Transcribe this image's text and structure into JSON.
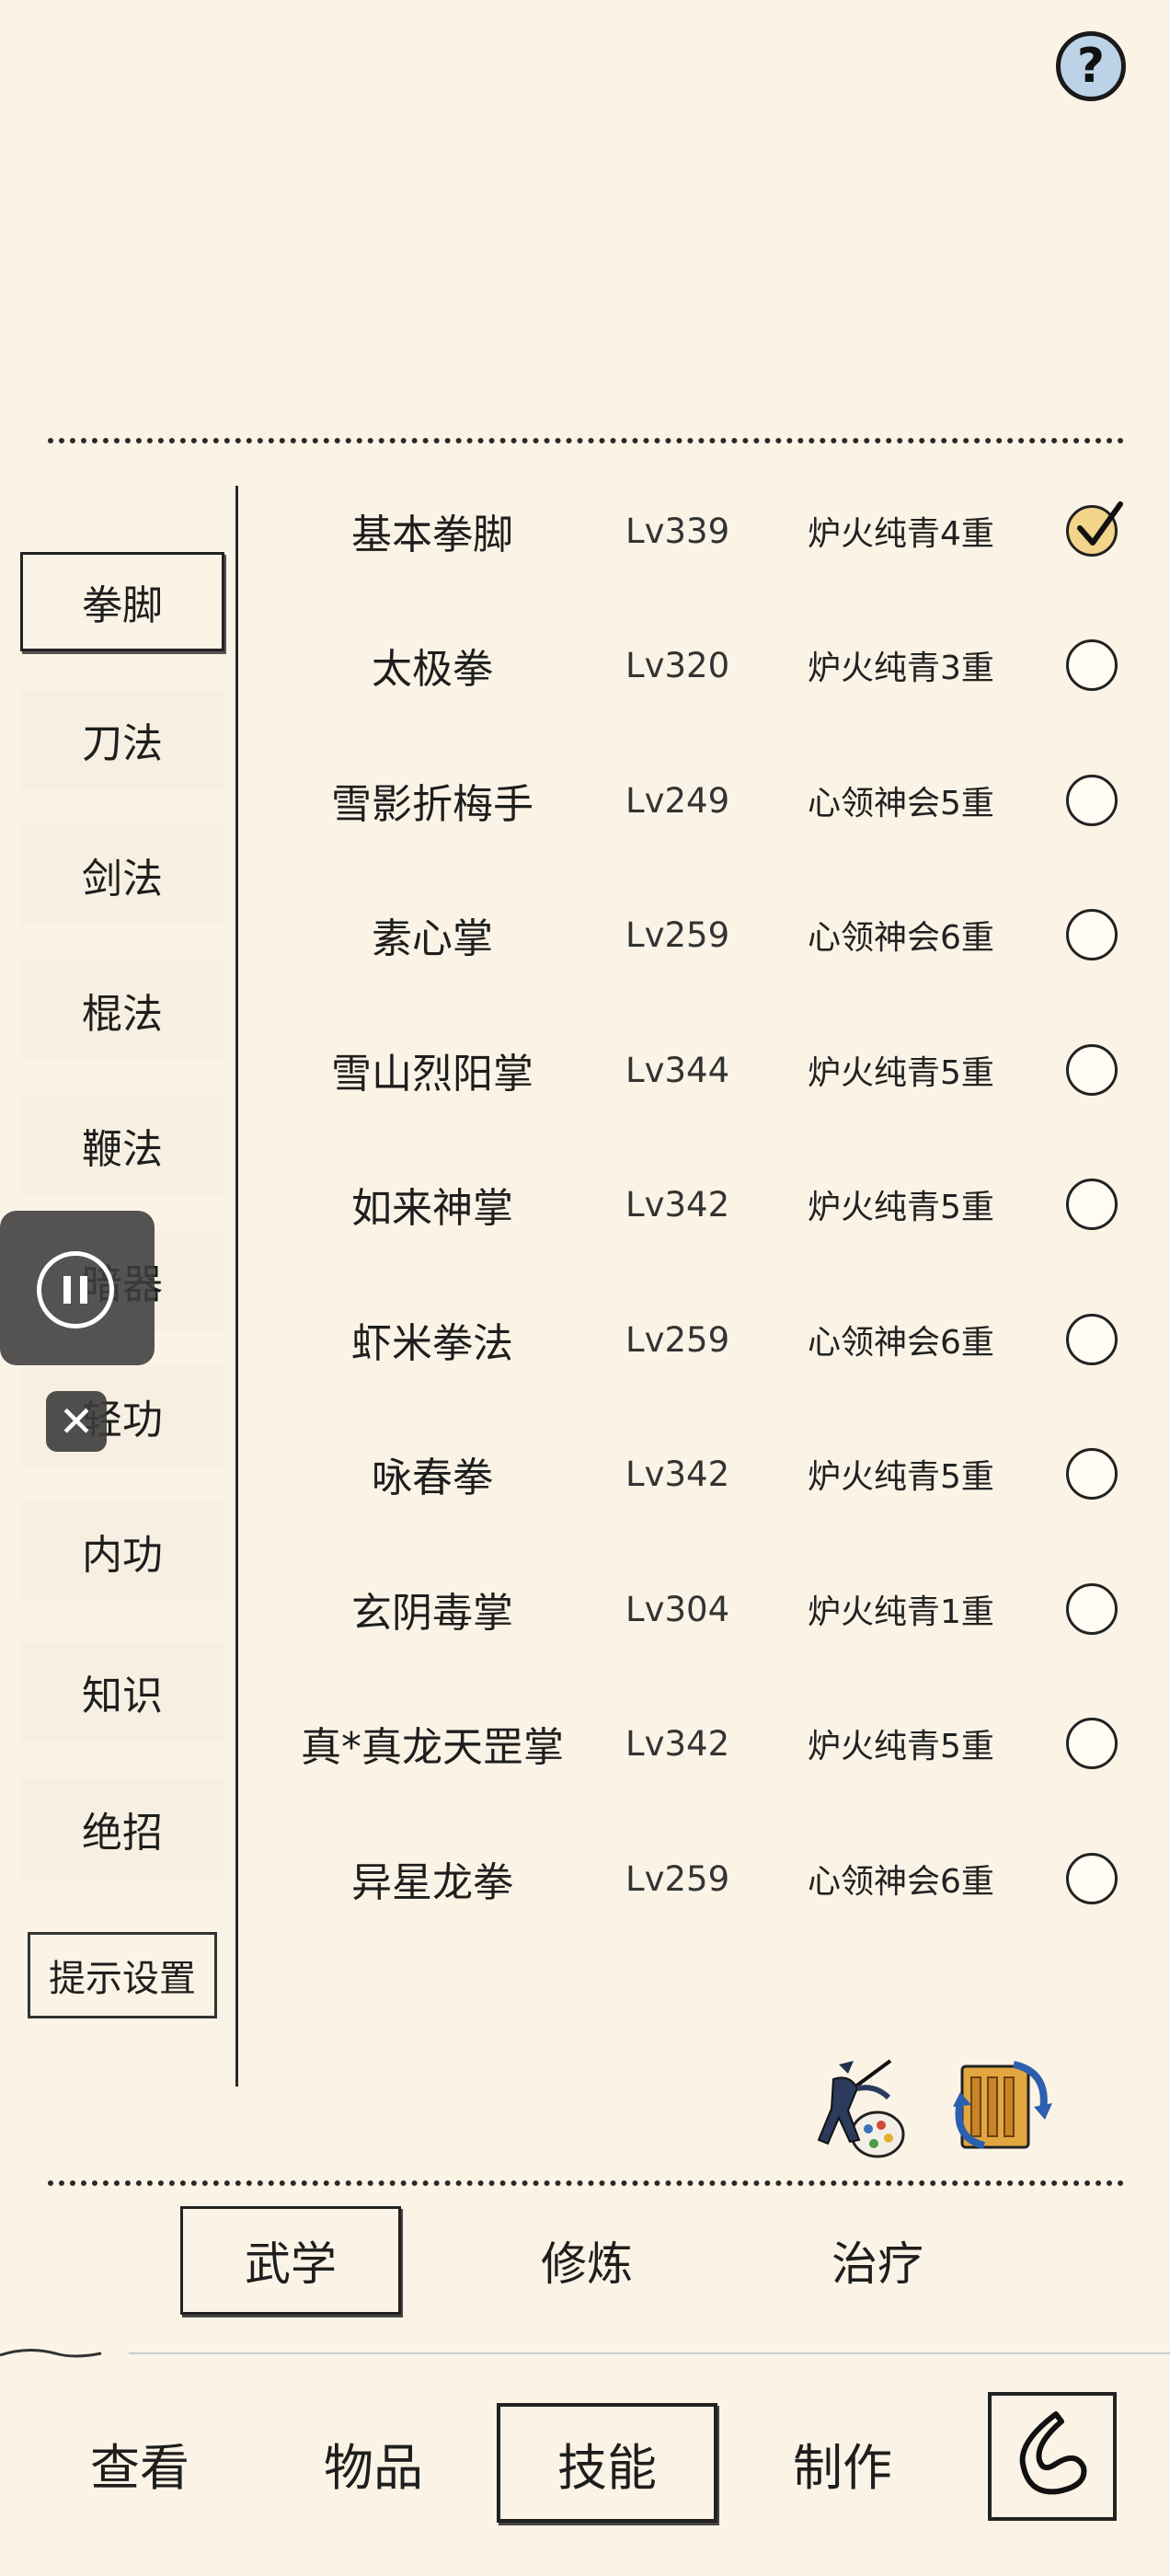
{
  "help": {
    "icon": "question-icon",
    "label": "?"
  },
  "categories": [
    {
      "label": "拳脚",
      "selected": true
    },
    {
      "label": "刀法",
      "selected": false
    },
    {
      "label": "剑法",
      "selected": false
    },
    {
      "label": "棍法",
      "selected": false
    },
    {
      "label": "鞭法",
      "selected": false
    },
    {
      "label": "暗器",
      "selected": false
    },
    {
      "label": "轻功",
      "selected": false
    },
    {
      "label": "内功",
      "selected": false
    },
    {
      "label": "知识",
      "selected": false
    },
    {
      "label": "绝招",
      "selected": false
    }
  ],
  "hint_settings_label": "提示设置",
  "skills": [
    {
      "name": "基本拳脚",
      "level": "Lv339",
      "rank": "炉火纯青4重",
      "checked": true
    },
    {
      "name": "太极拳",
      "level": "Lv320",
      "rank": "炉火纯青3重",
      "checked": false
    },
    {
      "name": "雪影折梅手",
      "level": "Lv249",
      "rank": "心领神会5重",
      "checked": false
    },
    {
      "name": "素心掌",
      "level": "Lv259",
      "rank": "心领神会6重",
      "checked": false
    },
    {
      "name": "雪山烈阳掌",
      "level": "Lv344",
      "rank": "炉火纯青5重",
      "checked": false
    },
    {
      "name": "如来神掌",
      "level": "Lv342",
      "rank": "炉火纯青5重",
      "checked": false
    },
    {
      "name": "虾米拳法",
      "level": "Lv259",
      "rank": "心领神会6重",
      "checked": false
    },
    {
      "name": "咏春拳",
      "level": "Lv342",
      "rank": "炉火纯青5重",
      "checked": false
    },
    {
      "name": "玄阴毒掌",
      "level": "Lv304",
      "rank": "炉火纯青1重",
      "checked": false
    },
    {
      "name": "真*真龙天罡掌",
      "level": "Lv342",
      "rank": "炉火纯青5重",
      "checked": false
    },
    {
      "name": "异星龙拳",
      "level": "Lv259",
      "rank": "心领神会6重",
      "checked": false
    }
  ],
  "tools": [
    {
      "icon": "martial-artist-palette-icon"
    },
    {
      "icon": "scroll-swap-icon"
    }
  ],
  "sub_tabs": [
    {
      "label": "武学",
      "selected": true
    },
    {
      "label": "修炼",
      "selected": false
    },
    {
      "label": "治疗",
      "selected": false
    }
  ],
  "nav_tabs": [
    {
      "label": "查看",
      "selected": false
    },
    {
      "label": "物品",
      "selected": false
    },
    {
      "label": "技能",
      "selected": true
    },
    {
      "label": "制作",
      "selected": false
    }
  ],
  "back_button": {
    "icon": "back-arrow-icon"
  },
  "overlay": {
    "pause_icon": "pause-icon",
    "close_icon": "close-icon",
    "close_glyph": "✕"
  },
  "colors": {
    "background": "#fbf4e6",
    "ink": "#1e1e1e",
    "check_fill": "#f2d48a",
    "help_fill": "#bcd2e6"
  }
}
